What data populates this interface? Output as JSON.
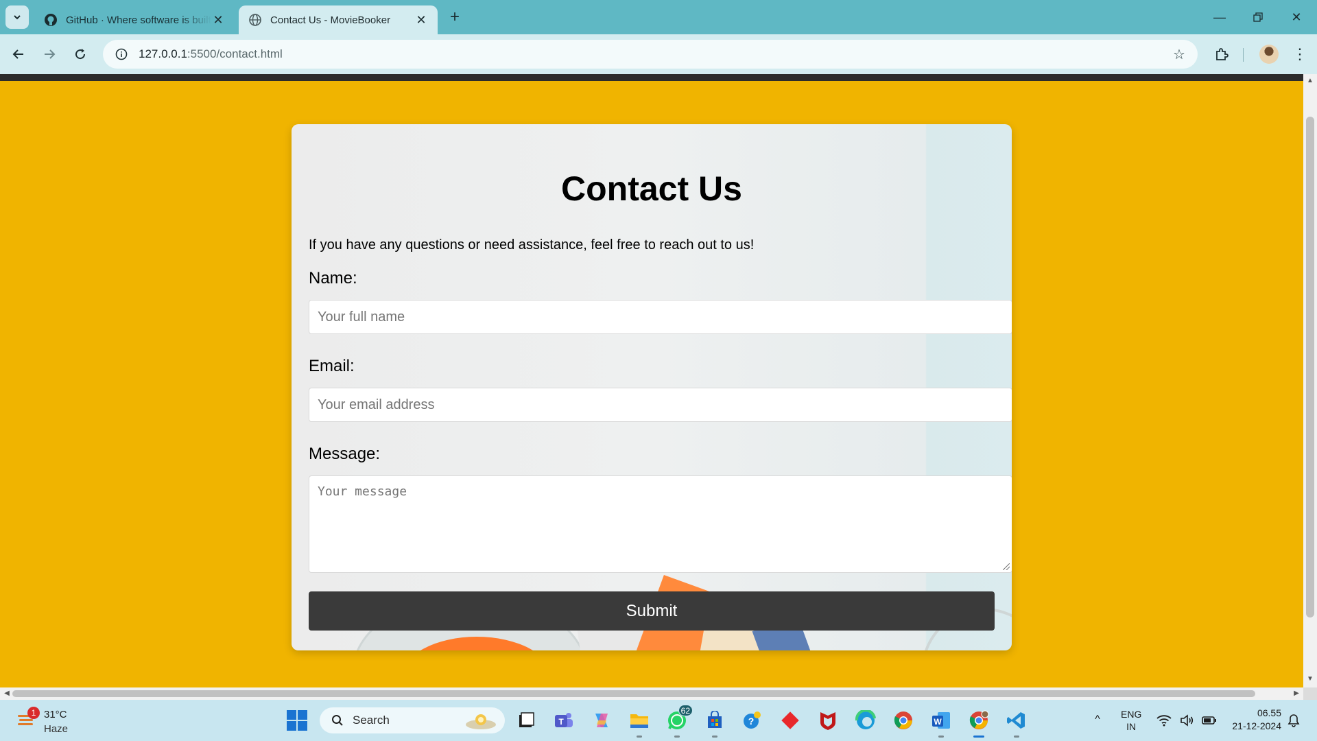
{
  "browser": {
    "tabs": [
      {
        "title": "GitHub · Where software is built",
        "icon": "github-icon",
        "active": false
      },
      {
        "title": "Contact Us - MovieBooker",
        "icon": "globe-icon",
        "active": true
      }
    ],
    "url_host": "127.0.0.1",
    "url_rest": ":5500/contact.html",
    "accent": "#5fb8c4"
  },
  "page": {
    "background": "#f0b400",
    "heading": "Contact Us",
    "intro": "If you have any questions or need assistance, feel free to reach out to us!",
    "form": {
      "name_label": "Name:",
      "name_placeholder": "Your full name",
      "email_label": "Email:",
      "email_placeholder": "Your email address",
      "message_label": "Message:",
      "message_placeholder": "Your message",
      "submit_label": "Submit"
    }
  },
  "taskbar": {
    "weather_temp": "31°C",
    "weather_cond": "Haze",
    "weather_badge": "1",
    "search_label": "Search",
    "whatsapp_badge": "62",
    "lang_line1": "ENG",
    "lang_line2": "IN",
    "time": "06.55",
    "date": "21-12-2024",
    "pinned": [
      "file-explorer-icon",
      "teams-icon",
      "copilot-icon",
      "folder-icon",
      "whatsapp-icon",
      "store-icon",
      "help-icon",
      "git-icon",
      "mcafee-icon",
      "edge-icon",
      "chrome-icon",
      "word-icon",
      "chrome-profile-icon",
      "vscode-icon"
    ]
  }
}
